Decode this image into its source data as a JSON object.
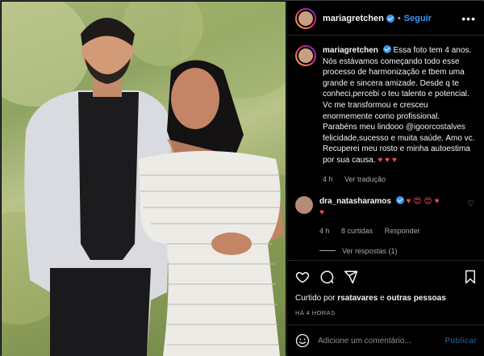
{
  "post": {
    "username": "mariagretchen",
    "follow_label": "Seguir",
    "more_label": "•••"
  },
  "caption": {
    "username": "mariagretchen",
    "text_before_mention": "Essa foto tem 4 anos. Nós estávamos começando todo esse processo de harmonização e tbem uma grande e sincera amizade. Desde q te conheci,percebi o teu talento e potencial. Vc me transformou e cresceu enormemente como profissional. Parabéns meu lindooo",
    "mention": "@igoorcostalves",
    "text_after_mention": "felicidade,sucesso e muita saúde. Amo vc. Recuperei meu rosto e minha autoestima por sua causa.",
    "emojis": "♥ ♥ ♥",
    "time": "4 h",
    "translate_label": "Ver tradução"
  },
  "comment": {
    "username": "dra_natasharamos",
    "emojis_line1": "♥ 😍 😍 ♥",
    "emojis_line2": "♥",
    "time": "4 h",
    "likes": "8 curtidas",
    "reply_label": "Responder",
    "view_replies": "Ver respostas (1)"
  },
  "footer": {
    "liked_prefix": "Curtido por ",
    "liked_user": "rsatavares",
    "liked_suffix": " e ",
    "liked_others": "outras pessoas",
    "timestamp": "HÁ 4 HORAS",
    "comment_placeholder": "Adicione um comentário...",
    "publish_label": "Publicar"
  },
  "colors": {
    "accent": "#3897f0",
    "heart": "#ed4956",
    "background": "#000000"
  },
  "icons": [
    "verified-badge-icon",
    "more-options-icon",
    "heart-icon",
    "comment-icon",
    "share-icon",
    "bookmark-icon",
    "emoji-icon"
  ]
}
